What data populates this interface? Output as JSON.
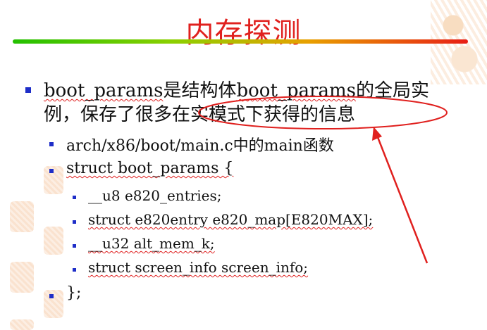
{
  "slide": {
    "title": "内存探测",
    "bullets": {
      "main_prefix": "boot_params",
      "main_rest_line1": "是结构体",
      "main_mid": "boot_params",
      "main_end_line1": "的全局实",
      "main_line2": "例，保存了很多在实模式下获得的信息",
      "sub1": "arch/x86/boot/main.c中的main函数",
      "sub2": "struct boot_params  {",
      "field1": "__u8  e820_entries;",
      "field2": "struct e820entry e820_map[E820MAX];",
      "field3": "__u32 alt_mem_k;",
      "field4": "struct screen_info screen_info;",
      "close": "};"
    }
  },
  "colors": {
    "title": "#e0201e",
    "bullet": "#1e2ec8",
    "annotation": "#e0201e"
  }
}
